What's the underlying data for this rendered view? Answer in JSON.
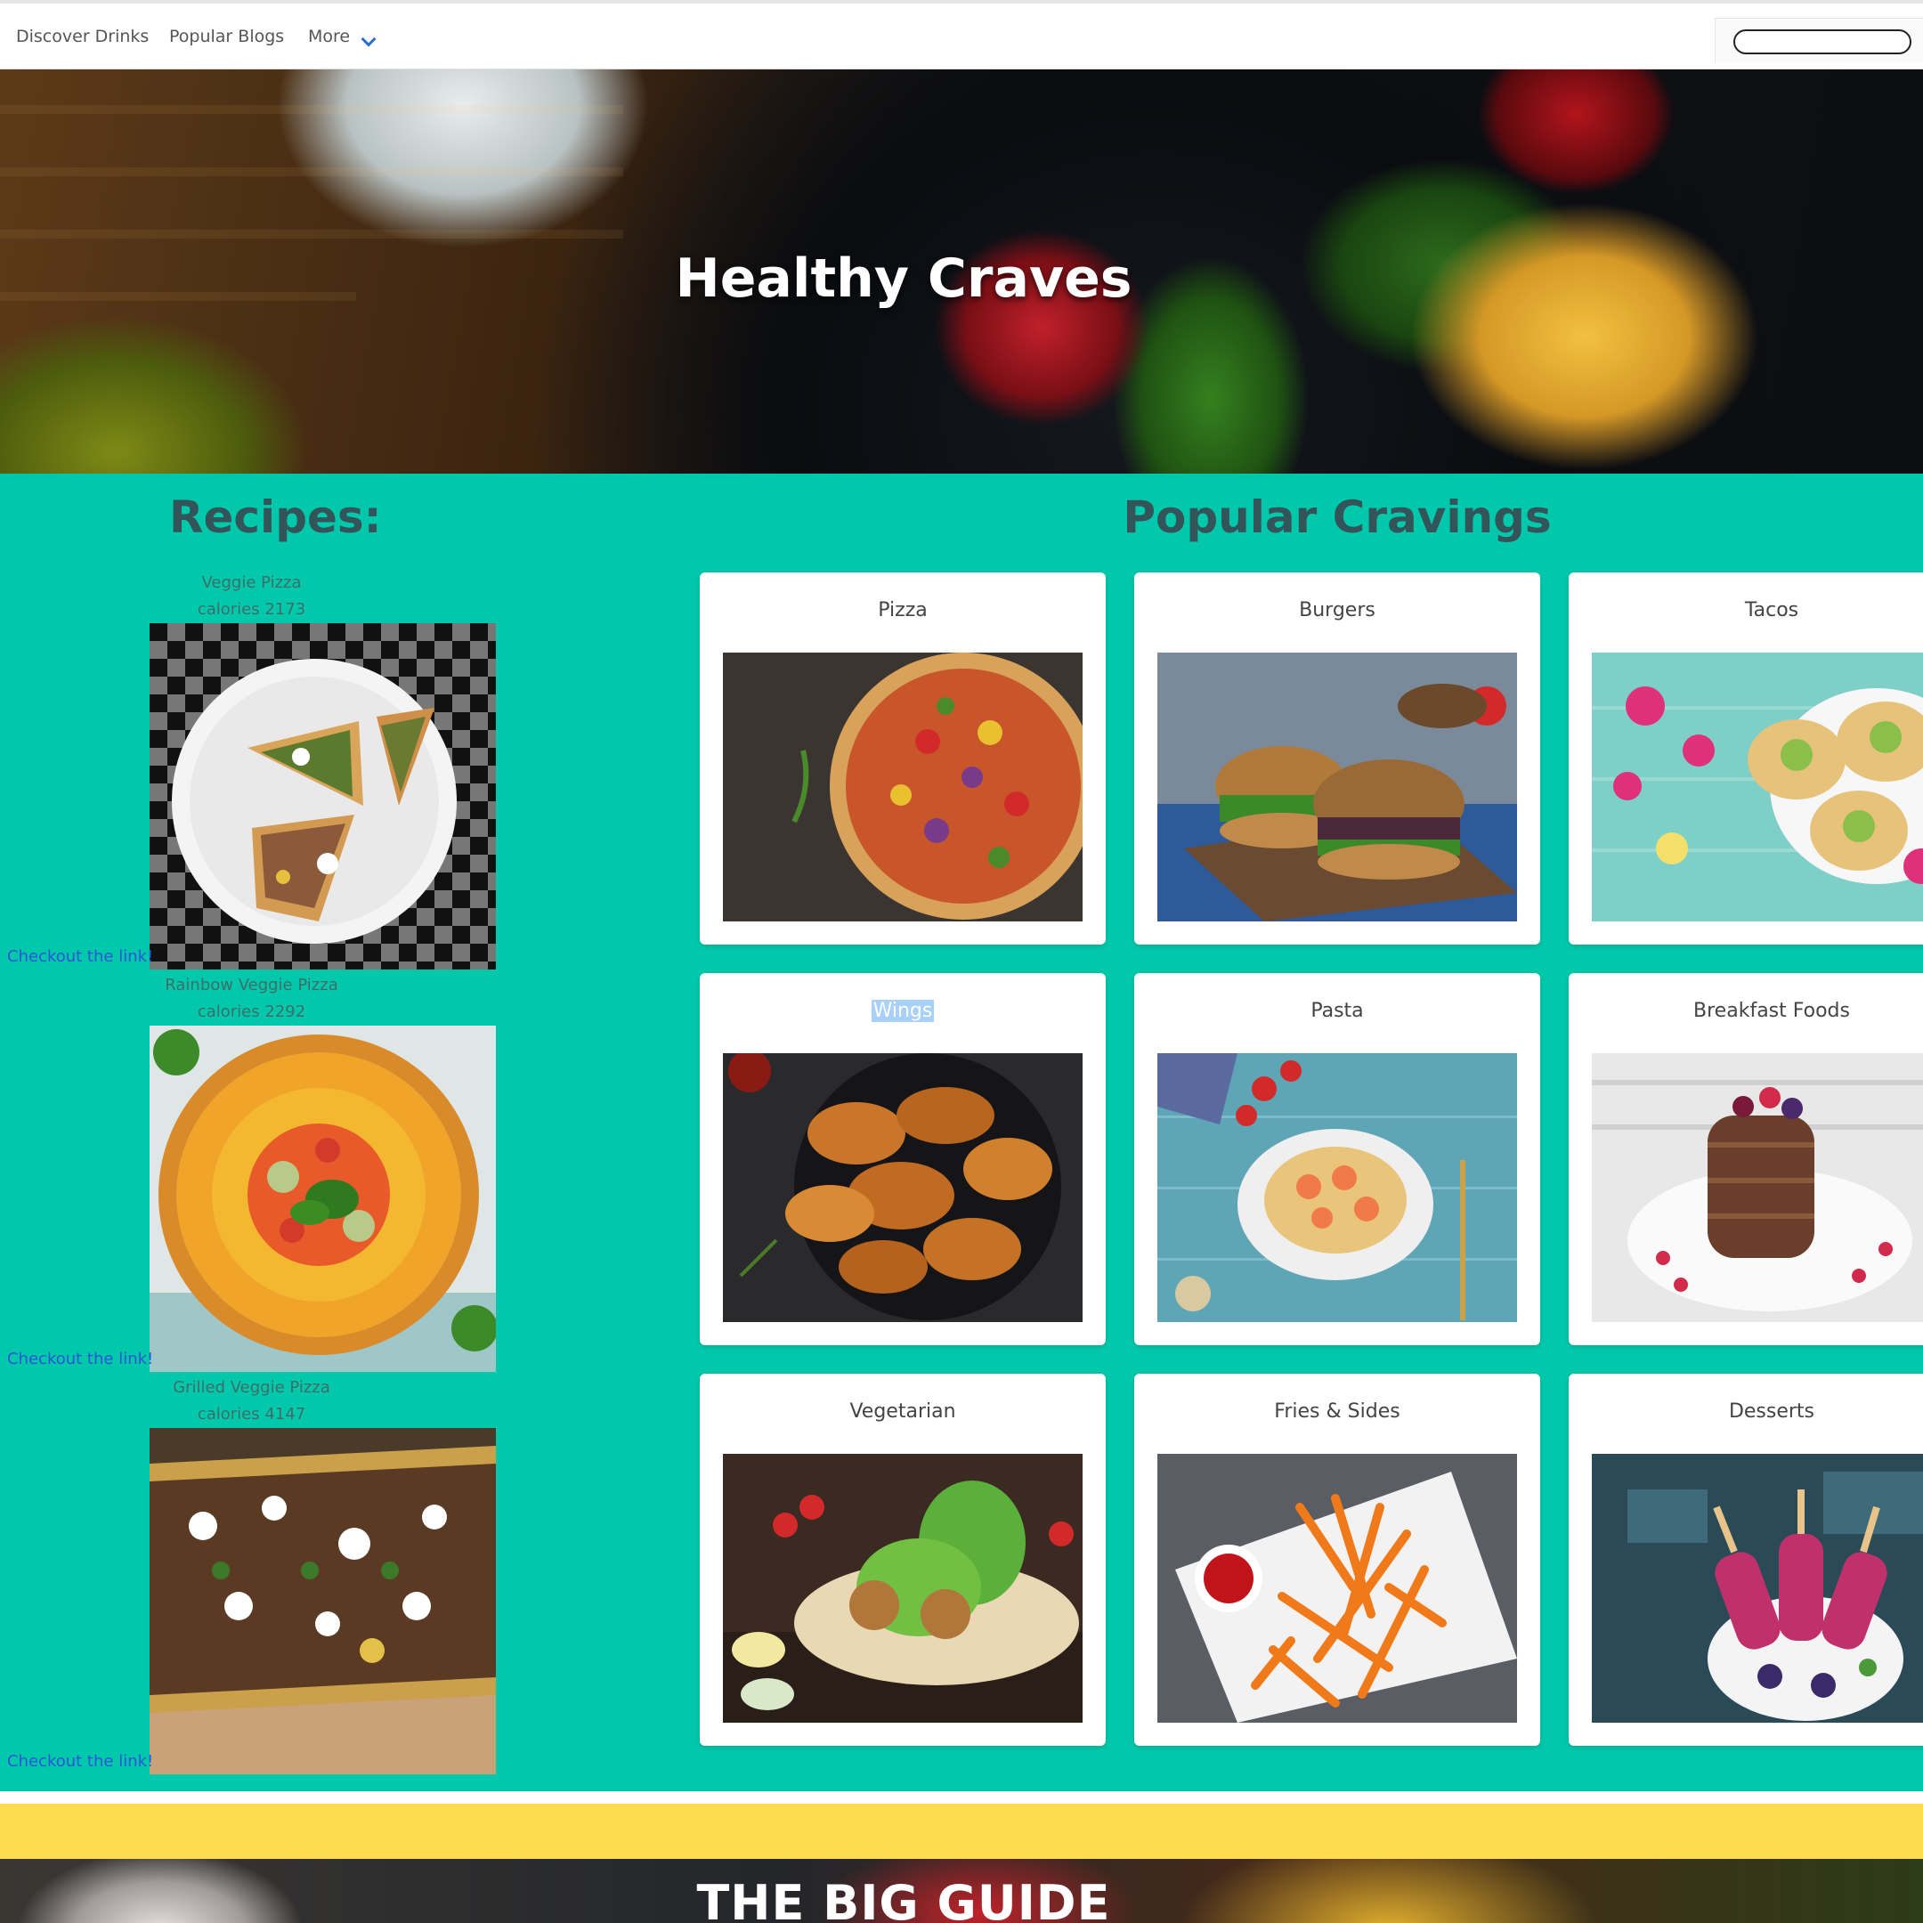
{
  "nav": {
    "links": [
      "Discover Drinks",
      "Popular Blogs",
      "More"
    ],
    "search_placeholder": ""
  },
  "hero": {
    "title": "Healthy Craves"
  },
  "recipes": {
    "heading": "Recipes:",
    "items": [
      {
        "name": "Veggie Pizza",
        "calories": "calories 2173",
        "link": "Checkout the link!"
      },
      {
        "name": "Rainbow Veggie Pizza",
        "calories": "calories 2292",
        "link": "Checkout the link!"
      },
      {
        "name": "Grilled Veggie Pizza",
        "calories": "calories 4147",
        "link": "Checkout the link!"
      }
    ]
  },
  "popular": {
    "heading": "Popular Cravings",
    "cards": [
      {
        "label": "Pizza"
      },
      {
        "label": "Burgers"
      },
      {
        "label": "Tacos"
      },
      {
        "label": "Wings"
      },
      {
        "label": "Pasta"
      },
      {
        "label": "Breakfast Foods"
      },
      {
        "label": "Vegetarian"
      },
      {
        "label": "Fries & Sides"
      },
      {
        "label": "Desserts"
      }
    ]
  },
  "bottom": {
    "title": "THE BIG GUIDE"
  },
  "colors": {
    "teal": "#02c8ab",
    "yellow": "#fedc50",
    "link_blue": "#2c56d8",
    "heading": "#33555a"
  }
}
